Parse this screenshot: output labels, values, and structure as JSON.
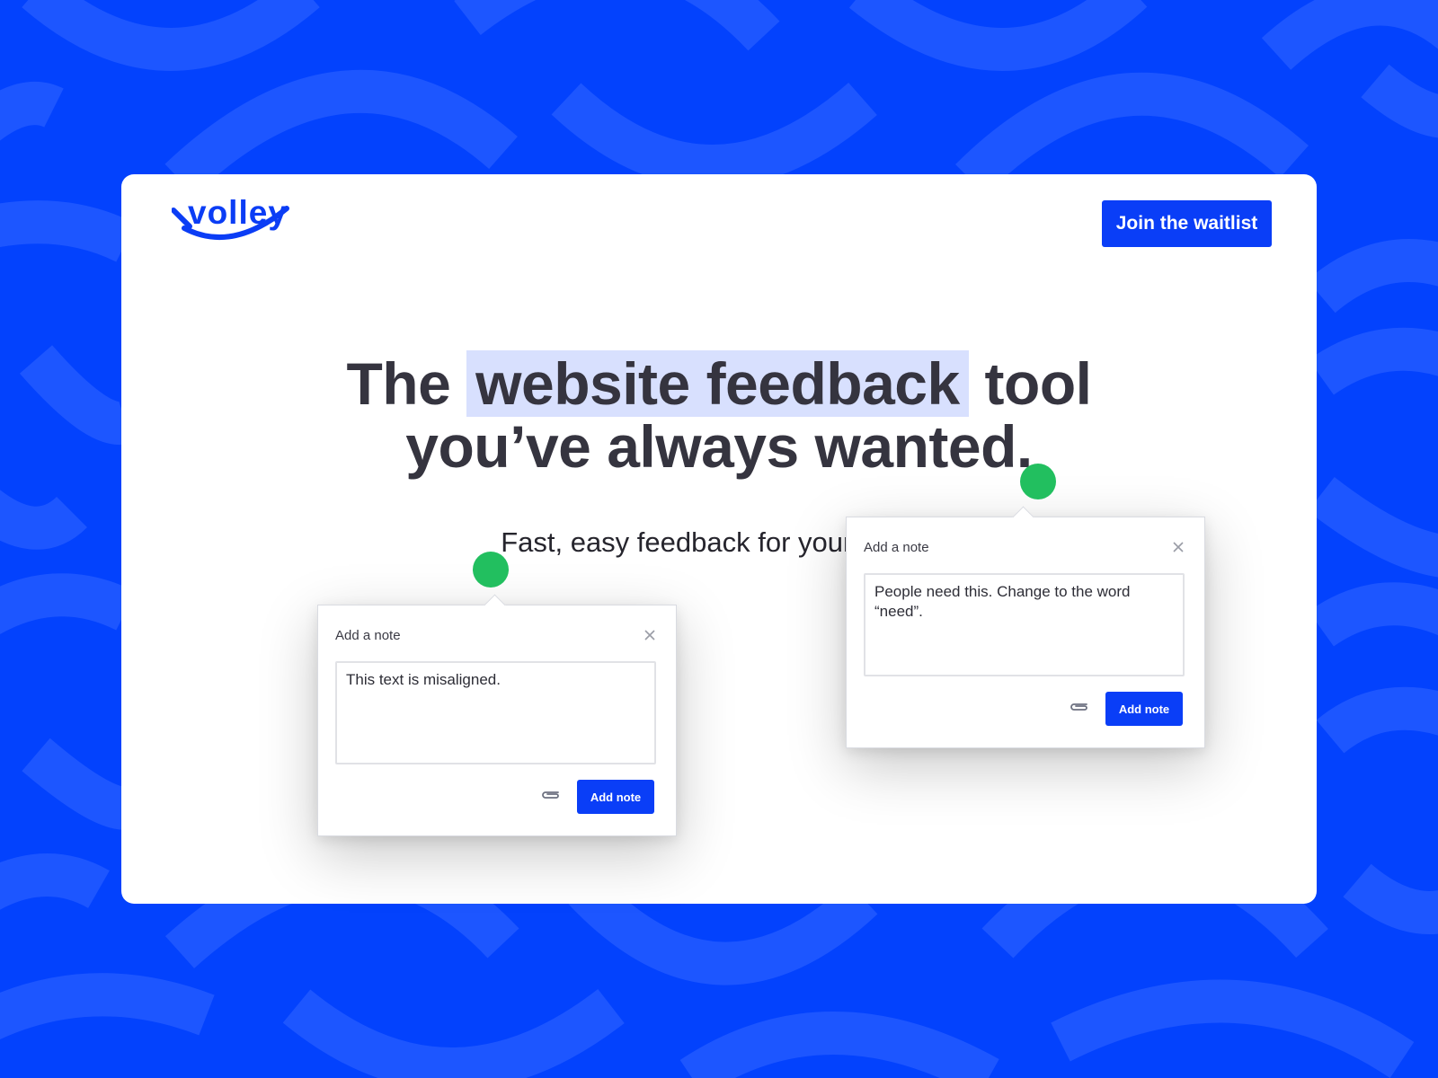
{
  "brand": {
    "logo_text": "volley",
    "primary_color": "#0342fd",
    "button_color": "#0a3ef7",
    "highlight_color": "#d8e0fe",
    "pin_color": "#22bf5f"
  },
  "header": {
    "cta_label": "Join the waitlist"
  },
  "hero": {
    "headline_pre": "The ",
    "headline_highlight": "website feedback",
    "headline_post": " tool",
    "headline_line2": "you’ve always wanted.",
    "subhead": "Fast, easy feedback for your websit"
  },
  "notes": [
    {
      "title": "Add a note",
      "value": "This text is misaligned.",
      "submit_label": "Add note",
      "attach_icon": "paperclip-icon",
      "close_icon": "close-icon"
    },
    {
      "title": "Add a note",
      "value": "People need this. Change to the word “need”.",
      "submit_label": "Add note",
      "attach_icon": "paperclip-icon",
      "close_icon": "close-icon"
    }
  ]
}
